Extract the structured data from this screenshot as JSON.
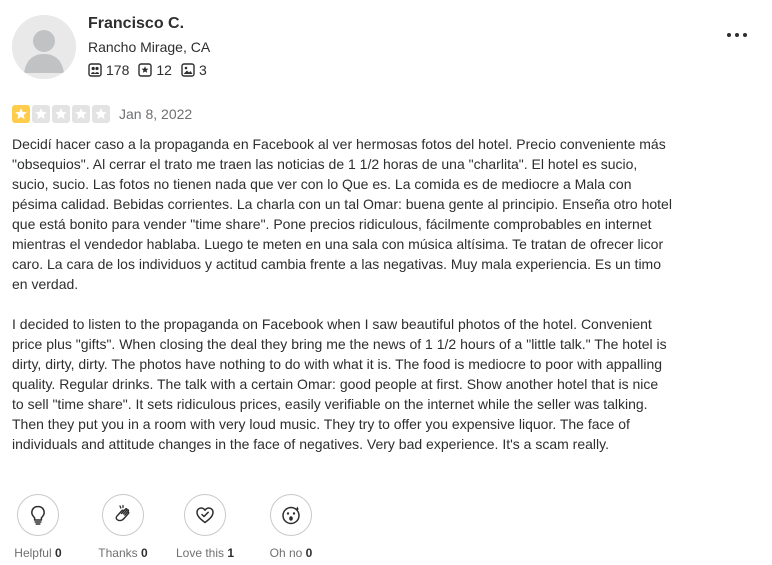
{
  "user": {
    "name": "Francisco C.",
    "location": "Rancho Mirage, CA",
    "friends_count": "178",
    "reviews_count": "12",
    "photos_count": "3"
  },
  "review": {
    "rating": 1,
    "max_rating": 5,
    "date": "Jan 8, 2022",
    "paragraphs": [
      "Decidí hacer caso a la propaganda en Facebook al ver hermosas fotos del hotel. Precio conveniente más \"obsequios\". Al cerrar el trato me traen las noticias de 1 1/2 horas de una \"charlita\". El hotel es sucio, sucio, sucio. Las fotos no tienen nada que ver con lo Que es. La comida es de mediocre a Mala con pésima calidad. Bebidas corrientes. La charla con un tal Omar: buena gente al principio. Enseña otro hotel que está bonito para vender \"time share\". Pone precios ridiculous, fácilmente comprobables en internet mientras el vendedor hablaba. Luego te meten en una sala con música altísima. Te tratan de ofrecer licor caro. La cara de los individuos y actitud cambia frente a las negativas. Muy mala experiencia. Es un timo en verdad.",
      "I decided to listen to the propaganda on Facebook when I saw beautiful photos of the hotel. Convenient price plus \"gifts\". When closing the deal they bring me the news of 1 1/2 hours of a \"little talk.\" The hotel is dirty, dirty, dirty. The photos have nothing to do with what it is. The food is mediocre to poor with appalling quality. Regular drinks. The talk with a certain Omar: good people at first. Show another hotel that is nice to sell \"time share\". It sets ridiculous prices, easily verifiable on the internet while the seller was talking. Then they put you in a room with very loud music. They try to offer you expensive liquor. The face of individuals and attitude changes in the face of negatives. Very bad experience. It's a scam really."
    ]
  },
  "reactions": {
    "helpful": {
      "label": "Helpful",
      "count": "0",
      "icon": "lightbulb-icon"
    },
    "thanks": {
      "label": "Thanks",
      "count": "0",
      "icon": "clapping-hands-icon"
    },
    "love_this": {
      "label": "Love this",
      "count": "1",
      "icon": "heart-icon"
    },
    "oh_no": {
      "label": "Oh no",
      "count": "0",
      "icon": "shocked-face-icon"
    }
  },
  "colors": {
    "star_on": "#ffcc4b",
    "star_off": "#e3e3e3",
    "text": "#2d2e2f",
    "muted": "#6e7072"
  }
}
